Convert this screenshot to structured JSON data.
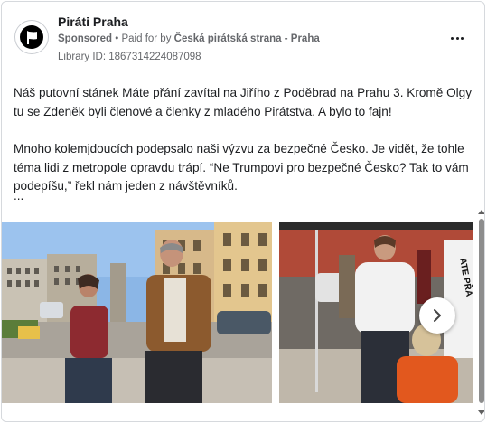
{
  "post": {
    "page_name": "Piráti Praha",
    "sponsored": "Sponsored",
    "separator": " • ",
    "paid_for_prefix": "Paid for by ",
    "paid_for_org": "Česká pirátská strana - Praha",
    "library_id": "Library ID: 1867314224087098",
    "paragraphs": [
      "Náš putovní stánek Máte přání zavítal na Jiřího z Poděbrad na Prahu 3. Kromě Olgy tu se Zdeněk byli členové a členky z mladého Pirátstva. A bylo to fajn!",
      "Mnoho kolemjdoucích podepsalo naši výzvu za bezpečné Česko. Je vidět, že tohle téma lidi z metropole opravdu trápí. “Ne Trumpovi pro bezpečné Česko? Tak to vám podepíšu,” řekl nám jeden z návštěvníků."
    ],
    "ellipsis": "..."
  },
  "icons": {
    "avatar": "pirate-flag-icon",
    "more": "more-options-icon",
    "next": "chevron-right-icon"
  },
  "photo2": {
    "sign_text": "ATE PŘÁ"
  },
  "colors": {
    "text": "#1c1e21",
    "secondary": "#65676b",
    "border": "#d6d9dd"
  }
}
